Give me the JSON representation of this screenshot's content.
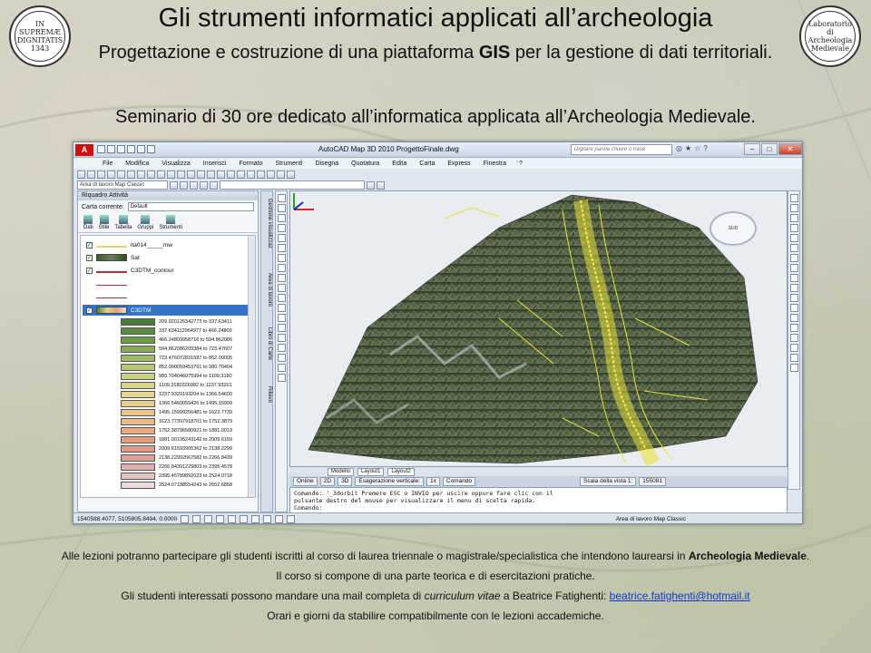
{
  "header": {
    "title": "Gli strumenti informatici applicati all’archeologia",
    "subtitle_before": "Progettazione e costruzione di una piattaforma ",
    "subtitle_bold": "GIS",
    "subtitle_after": " per la gestione di dati territoriali.",
    "seminar": "Seminario di 30 ore dedicato all’informatica applicata all’Archeologia Medievale.",
    "logo_left_text": "IN SUPREMÆ DIGNITATIS 1343",
    "logo_right_text": "Laboratorio di Archeologia Medievale"
  },
  "app": {
    "badge": "A",
    "window_title": "AutoCAD Map 3D 2010     ProgettoFinale.dwg",
    "search_placeholder": "Digitare parola chiave o frase",
    "window_controls": [
      "–",
      "□",
      "✕"
    ],
    "menu": [
      "File",
      "Modifica",
      "Visualizza",
      "Inserisci",
      "Formato",
      "Strumenti",
      "Disegna",
      "Quotatura",
      "Edita",
      "Carta",
      "Express",
      "Finestra",
      "?"
    ],
    "workspace_select": "Area di lavoro Map Classic",
    "palette": {
      "header": "Riquadro Attività",
      "map_label": "Carta corrente:",
      "map_value": "Default",
      "tabs": [
        "Dati",
        "Stile",
        "Tabella",
        "Gruppi",
        "Strumenti"
      ],
      "layers": [
        {
          "name": "ita014_____mw",
          "checked": "✓"
        },
        {
          "name": "Sat",
          "checked": "✓"
        },
        {
          "name": "C3DTM_contour",
          "checked": "✓"
        },
        {
          "name": "",
          "checked": ""
        },
        {
          "name": "",
          "checked": ""
        },
        {
          "name": "C3DTM",
          "checked": "✓"
        }
      ],
      "legend": [
        {
          "label": "209.020126342773 to 337.63411",
          "color": "#4a7d3a"
        },
        {
          "label": "337.634112964977 to 466.24809",
          "color": "#5b8a42"
        },
        {
          "label": "466.24809958716 to 594.862086",
          "color": "#6f9a4c"
        },
        {
          "label": "594.862086209384 to 723.47607",
          "color": "#86aa57"
        },
        {
          "label": "723.476072831587 to 852.09005",
          "color": "#9db864"
        },
        {
          "label": "852.090059453791 to 980.70404",
          "color": "#b5c572"
        },
        {
          "label": "980.704046075994 to 1109.3180",
          "color": "#c9cf80"
        },
        {
          "label": "1109.3180326982 to 1237.93201",
          "color": "#d9d58c"
        },
        {
          "label": "1237.9320193204 to 1366.54600",
          "color": "#e2d690"
        },
        {
          "label": "1366.5460059426 to 1495.15999",
          "color": "#e7cf8c"
        },
        {
          "label": "1495.15999256481 to 1623.7739",
          "color": "#e9c487"
        },
        {
          "label": "1623.77397918701 to 1752.3879",
          "color": "#e9b883"
        },
        {
          "label": "1752.38796580921 to 1881.0019",
          "color": "#e6ab80"
        },
        {
          "label": "1881.00195243142 to 2009.6159",
          "color": "#e2a07f"
        },
        {
          "label": "2009.61593905362 to 2138.2299",
          "color": "#de9a85"
        },
        {
          "label": "2138.22992567582 to 2266.8439",
          "color": "#dba39a"
        },
        {
          "label": "2266.84391229803 to 2395.4578",
          "color": "#dcb0ac"
        },
        {
          "label": "2395.45789892023 to 2524.0718",
          "color": "#e2c4c2"
        },
        {
          "label": "2524.07188554243 to 2652.6858",
          "color": "#ecdbda"
        }
      ],
      "vertical_tabs": [
        "Gestione visualizzaz",
        "Area di lavoro",
        "Libro di Carte",
        "Rilievo"
      ]
    },
    "viewport": {
      "nav_label": "SUD",
      "layout_tabs": [
        "Modello",
        "Layout1",
        "Layout2"
      ],
      "status_items": [
        "Online",
        "2D",
        "3D",
        "Esagerazione verticale:",
        "1x",
        "Comando",
        "Scala della vista 1:",
        "155081"
      ],
      "command_lines": [
        "Comando: '_3dorbit Premere ESC o INVIO per uscire oppure fare clic con il",
        "pulsante destro del mouse per visualizzare il menu di scelta rapida.",
        "Comando:"
      ]
    },
    "statusbar": {
      "coords": "1540588.4077, 5105805.8494, 0.0000",
      "workspace": "Area di lavoro Map Classic"
    }
  },
  "body": {
    "p1_before": "Alle lezioni potranno partecipare gli studenti iscritti al corso di laurea triennale o magistrale/specialistica che intendono laurearsi in ",
    "p1_bold": "Archeologia Medievale",
    "p1_after": ".",
    "p2": "Il corso si compone di una parte teorica e di esercitazioni pratiche.",
    "p3_before": "Gli studenti interessati possono mandare una mail completa di ",
    "p3_italic": "curriculum vitae",
    "p3_middle": " a Beatrice Fatighenti: ",
    "p3_link": "beatrice.fatighenti@hotmail.it",
    "p4": "Orari e giorni da stabilire compatibilmente con le lezioni accademiche."
  }
}
